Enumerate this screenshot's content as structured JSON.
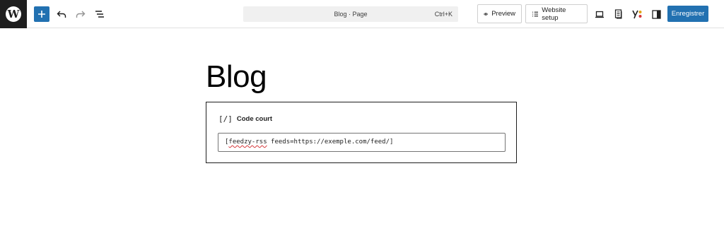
{
  "toolbar": {
    "logo_letter": "W",
    "document_title": "Blog · Page",
    "command_shortcut": "Ctrl+K",
    "preview_label": "Preview",
    "setup_label": "Website setup",
    "save_label": "Enregistrer",
    "accent_color": "#2271b1"
  },
  "editor": {
    "page_title": "Blog",
    "block": {
      "icon_text": "[/]",
      "label": "Code court",
      "shortcode_prefix": "[",
      "shortcode_misspelled": "feedzy-rss",
      "shortcode_rest": " feeds=https://exemple.com/feed/]"
    }
  }
}
